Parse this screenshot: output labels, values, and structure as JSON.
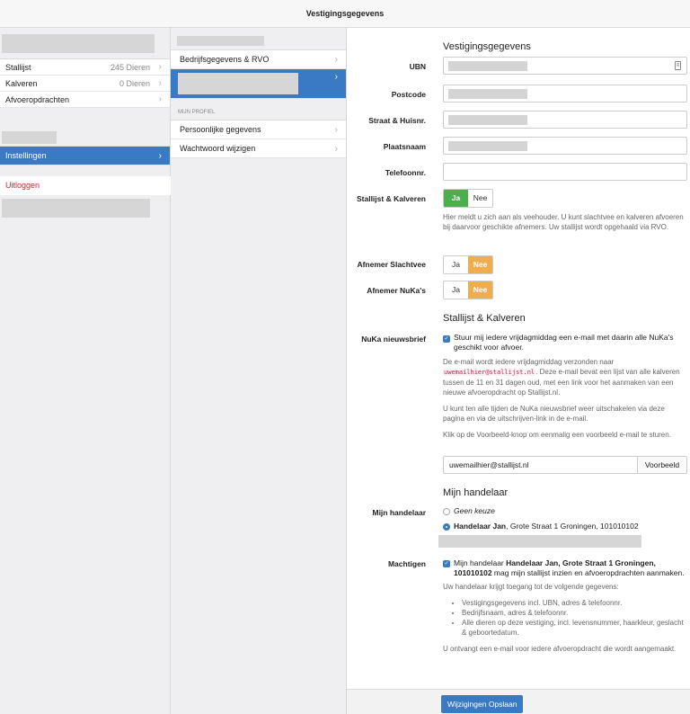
{
  "header": {
    "title": "Vestigingsgegevens"
  },
  "sidebar": {
    "items": [
      {
        "label": "Stallijst",
        "value": "245 Dieren"
      },
      {
        "label": "Kalveren",
        "value": "0 Dieren"
      },
      {
        "label": "Afvoeropdrachten",
        "value": ""
      }
    ],
    "settings": {
      "label": "Instellingen"
    },
    "logout": {
      "label": "Uitloggen"
    }
  },
  "submenu": {
    "items": [
      {
        "label": "Bedrijfsgegevens & RVO"
      }
    ],
    "profile_caption": "MIJN PROFIEL",
    "profile_items": [
      {
        "label": "Persoonlijke gegevens"
      },
      {
        "label": "Wachtwoord wijzigen"
      }
    ]
  },
  "form": {
    "section_title": "Vestigingsgegevens",
    "fields": {
      "ubn": "UBN",
      "postcode": "Postcode",
      "straat": "Straat & Huisnr.",
      "plaats": "Plaatsnaam",
      "telefoon": "Telefoonnr."
    },
    "stallijst": {
      "label": "Stallijst & Kalveren",
      "yes": "Ja",
      "no": "Nee",
      "help": "Hier meldt u zich aan als veehouder. U kunt slachtvee en kalveren afvoeren bij daarvoor geschikte afnemers. Uw stallijst wordt opgehaald via RVO."
    },
    "afnemer_slachtvee": {
      "label": "Afnemer Slachtvee",
      "yes": "Ja",
      "no": "Nee"
    },
    "afnemer_nuka": {
      "label": "Afnemer NuKa's",
      "yes": "Ja",
      "no": "Nee"
    },
    "stallijst_section": "Stallijst & Kalveren",
    "nuka": {
      "label": "NuKa nieuwsbrief",
      "check_text": "Stuur mij iedere vrijdagmiddag een e-mail met daarin alle NuKa's geschikt voor afvoer.",
      "help1_pre": "De e-mail wordt iedere vrijdagmiddag verzonden naar",
      "help1_email": "uwemailhier@stallijst.nl",
      "help1_post": ". Deze e-mail bevat een lijst van alle kalveren tussen de 11 en 31 dagen oud, met een link voor het aanmaken van een nieuwe afvoeropdracht op Stallijst.nl.",
      "help2": "U kunt ten alle tijden de NuKa nieuwsbrief weer uitschakelen via deze pagina en via de uitschrijven-link in de e-mail.",
      "help3": "Klik op de Voorbeeld-knop om eenmalig een voorbeeld e-mail te sturen.",
      "email_value": "uwemailhier@stallijst.nl",
      "preview_button": "Voorbeeld"
    },
    "handelaar_section": "Mijn handelaar",
    "handelaar": {
      "label": "Mijn handelaar",
      "none": "Geen keuze",
      "selected_name": "Handelaar Jan",
      "selected_addr": ", Grote Straat 1 Groningen, 101010102"
    },
    "machtigen": {
      "label": "Machtigen",
      "pre": "Mijn handelaar",
      "bold": "Handelaar Jan, Grote Straat 1 Groningen, 101010102",
      "post": "mag mijn stallijst inzien en afvoeropdrachten aanmaken.",
      "intro": "Uw handelaar krijgt toegang tot de volgende gegevens:",
      "bullets": [
        "Vestigingsgegevens incl. UBN, adres & telefoonnr.",
        "Bedrijfsnaam, adres & telefoonnr.",
        "Alle dieren op deze vestiging, incl. levensnummer, haarkleur, geslacht & geboortedatum."
      ],
      "outro": "U ontvangt een e-mail voor iedere afvoeropdracht die wordt aangemaakt."
    },
    "save_button": "Wijzigingen Opslaan"
  }
}
